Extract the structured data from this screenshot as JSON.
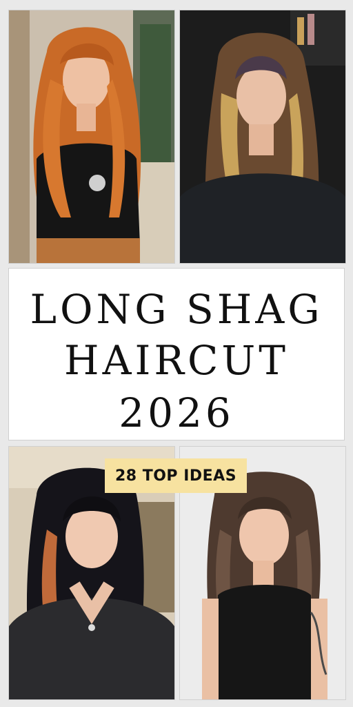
{
  "title": {
    "line1": "LONG SHAG",
    "line2": "HAIRCUT",
    "line3": "2026"
  },
  "badge": "28 TOP IDEAS",
  "colors": {
    "badge_bg": "#f7e2a0",
    "title_bg": "#ffffff",
    "background": "#e9e9e9"
  },
  "photos": [
    {
      "name": "photo-woman-copper-shag",
      "icon": "photo-icon"
    },
    {
      "name": "photo-woman-highlighted-shag",
      "icon": "photo-icon"
    },
    {
      "name": "photo-woman-dark-shag-copper-streaks",
      "icon": "photo-icon"
    },
    {
      "name": "photo-woman-brunette-wavy-shag",
      "icon": "photo-icon"
    }
  ]
}
